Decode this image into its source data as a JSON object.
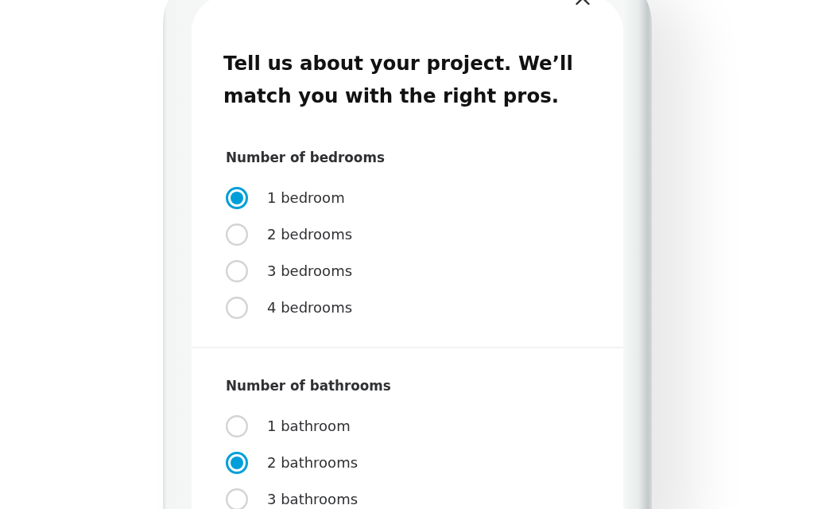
{
  "title": "Tell us about your project. We’ll match you with the right pros.",
  "questions": [
    {
      "label": "Number of bedrooms",
      "options": [
        {
          "label": "1 bedroom",
          "selected": true
        },
        {
          "label": "2 bedrooms",
          "selected": false
        },
        {
          "label": "3 bedrooms",
          "selected": false
        },
        {
          "label": "4 bedrooms",
          "selected": false
        }
      ]
    },
    {
      "label": "Number of bathrooms",
      "options": [
        {
          "label": "1 bathroom",
          "selected": false
        },
        {
          "label": "2 bathrooms",
          "selected": true
        },
        {
          "label": "3 bathrooms",
          "selected": false
        }
      ]
    }
  ]
}
